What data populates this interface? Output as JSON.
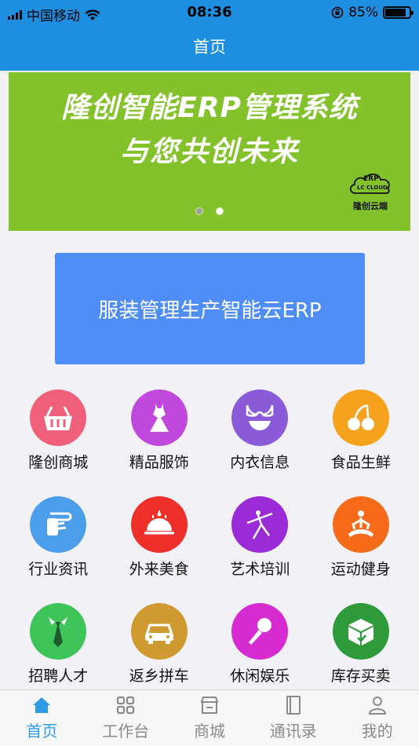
{
  "status_bar": {
    "carrier": "中国移动",
    "time": "08:36",
    "battery": "85%",
    "battery_level": 0.85
  },
  "nav": {
    "title": "首页"
  },
  "banner": {
    "line1": "隆创智能ERP管理系统",
    "line2": "与您共创未来",
    "logo_top": "ERP",
    "logo_mid": "LC CLOUD",
    "logo_caption": "隆创云端",
    "slide_count": 2,
    "active_slide": 2,
    "bg_color": "#84c22b"
  },
  "promo": {
    "label": "服装管理生产智能云ERP",
    "color": "#4f8ef6"
  },
  "grid": [
    {
      "label": "隆创商城",
      "icon": "basket-icon",
      "color": "#f0607a"
    },
    {
      "label": "精品服饰",
      "icon": "dress-icon",
      "color": "#c048dc"
    },
    {
      "label": "内衣信息",
      "icon": "lingerie-icon",
      "color": "#8a5ad8"
    },
    {
      "label": "食品生鲜",
      "icon": "cherry-icon",
      "color": "#f6a21c"
    },
    {
      "label": "行业资讯",
      "icon": "newspaper-icon",
      "color": "#4a9eea"
    },
    {
      "label": "外来美食",
      "icon": "cloche-icon",
      "color": "#ee2f2a"
    },
    {
      "label": "艺术培训",
      "icon": "dancer-icon",
      "color": "#9b2bd6"
    },
    {
      "label": "运动健身",
      "icon": "yoga-icon",
      "color": "#f66a1a"
    },
    {
      "label": "招聘人才",
      "icon": "tie-icon",
      "color": "#3fc45a"
    },
    {
      "label": "返乡拼车",
      "icon": "car-icon",
      "color": "#cf9b30"
    },
    {
      "label": "休闲娱乐",
      "icon": "microphone-icon",
      "color": "#d62bd0"
    },
    {
      "label": "库存买卖",
      "icon": "box-icon",
      "color": "#2f9a3a"
    }
  ],
  "tabs": [
    {
      "label": "首页",
      "icon": "home-icon",
      "active": true
    },
    {
      "label": "工作台",
      "icon": "grid-icon",
      "active": false
    },
    {
      "label": "商城",
      "icon": "store-icon",
      "active": false
    },
    {
      "label": "通讯录",
      "icon": "contacts-book-icon",
      "active": false
    },
    {
      "label": "我的",
      "icon": "user-icon",
      "active": false
    }
  ]
}
